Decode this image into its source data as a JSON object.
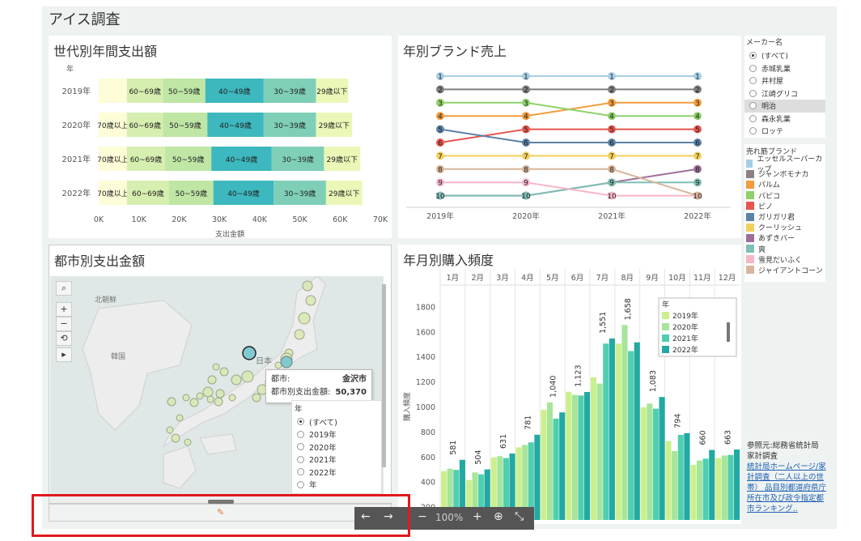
{
  "dashboard_title": "アイス調査",
  "gen_chart": {
    "title": "世代別年間支出額",
    "year_header": "年",
    "xlabel": "支出金額",
    "xticks": [
      "0K",
      "10K",
      "20K",
      "30K",
      "40K",
      "50K",
      "60K",
      "70K"
    ],
    "chart_data": {
      "type": "bar",
      "stacked": true,
      "orientation": "horizontal",
      "categories": [
        "2019年",
        "2020年",
        "2021年",
        "2022年"
      ],
      "series": [
        {
          "name": "70歳以上",
          "values": [
            7000,
            7000,
            7000,
            7000
          ],
          "color": "#fdfdd8"
        },
        {
          "name": "60~69歳",
          "values": [
            9000,
            9000,
            9500,
            10500
          ],
          "color": "#d6eeaf"
        },
        {
          "name": "50~59歳",
          "values": [
            10500,
            11000,
            11500,
            11000
          ],
          "color": "#bfe6a4"
        },
        {
          "name": "40~49歳",
          "values": [
            14500,
            14000,
            15000,
            15000
          ],
          "color": "#3cb8be"
        },
        {
          "name": "30~39歳",
          "values": [
            13000,
            13000,
            13000,
            13000
          ],
          "color": "#7fcfb8"
        },
        {
          "name": "29歳以下",
          "values": [
            8000,
            9000,
            9000,
            9000
          ],
          "color": "#eaf7b7"
        }
      ],
      "xlim": [
        0,
        70000
      ],
      "xlabel": "支出金額"
    }
  },
  "brand_chart": {
    "title": "年別ブランド売上",
    "chart_data": {
      "type": "line",
      "x": [
        "2019年",
        "2020年",
        "2021年",
        "2022年"
      ],
      "series": [
        {
          "name": "エッセルスーパーカップ",
          "values": [
            1,
            1,
            1,
            1
          ],
          "color": "#a6cee3"
        },
        {
          "name": "ジャンボモナカ",
          "values": [
            2,
            2,
            2,
            2
          ],
          "color": "#7f7f7f"
        },
        {
          "name": "パルム",
          "values": [
            4,
            4,
            3,
            3
          ],
          "color": "#f39c3d"
        },
        {
          "name": "パピコ",
          "values": [
            3,
            3,
            4,
            4
          ],
          "color": "#8ed16b"
        },
        {
          "name": "ピノ",
          "values": [
            6,
            5,
            5,
            5
          ],
          "color": "#e8554e"
        },
        {
          "name": "ガリガリ君",
          "values": [
            5,
            6,
            6,
            6
          ],
          "color": "#5b82a6"
        },
        {
          "name": "クーリッシュ",
          "values": [
            7,
            7,
            7,
            7
          ],
          "color": "#f2cf5b"
        },
        {
          "name": "あずきバー",
          "values": [
            10,
            10,
            9,
            8
          ],
          "color": "#9e6e9b"
        },
        {
          "name": "爽",
          "values": [
            10,
            10,
            9,
            9
          ],
          "color": "#7fbfb6"
        },
        {
          "name": "雪見だいふく",
          "values": [
            9,
            9,
            10,
            10
          ],
          "color": "#f7b6c8"
        },
        {
          "name": "ジャイアントコーン",
          "values": [
            8,
            8,
            8,
            10
          ],
          "color": "#d9b59a"
        }
      ],
      "ranks_scale": [
        1,
        10
      ]
    }
  },
  "maker_legend": {
    "title": "メーカー名",
    "items": [
      "(すべて)",
      "赤城乳業",
      "井村屋",
      "江崎グリコ",
      "明治",
      "森永乳業",
      "ロッテ"
    ],
    "selected_index": 0,
    "highlighted_index": 4
  },
  "brand_legend": {
    "title": "売れ筋ブランド",
    "items": [
      {
        "label": "エッセルスーパーカップ",
        "color": "#a6cee3"
      },
      {
        "label": "ジャンボモナカ",
        "color": "#8c8080"
      },
      {
        "label": "パルム",
        "color": "#f39c3d"
      },
      {
        "label": "パピコ",
        "color": "#8ed16b"
      },
      {
        "label": "ピノ",
        "color": "#e8554e"
      },
      {
        "label": "ガリガリ君",
        "color": "#5b82a6"
      },
      {
        "label": "クーリッシュ",
        "color": "#f2cf5b"
      },
      {
        "label": "あずきバー",
        "color": "#9e6e9b"
      },
      {
        "label": "爽",
        "color": "#7fbfb6"
      },
      {
        "label": "雪見だいふく",
        "color": "#f7b6c8"
      },
      {
        "label": "ジャイアントコーン",
        "color": "#d9b59a"
      }
    ]
  },
  "map": {
    "title": "都市別支出金額",
    "label_korea_north": "北朝鮮",
    "label_korea": "韓国",
    "label_japan": "日本",
    "tooltip": {
      "city_label": "都市:",
      "city_value": "金沢市",
      "amount_label": "都市別支出金額:",
      "amount_value": "50,370"
    },
    "year_filter": {
      "title": "年",
      "items": [
        "(すべて)",
        "2019年",
        "2020年",
        "2021年",
        "2022年",
        "年"
      ],
      "selected_index": 0
    }
  },
  "freq_chart": {
    "title": "年月別購入頻度",
    "ylabel": "購入頻度",
    "months": [
      "1月",
      "2月",
      "3月",
      "4月",
      "5月",
      "6月",
      "7月",
      "8月",
      "9月",
      "10月",
      "11月",
      "12月"
    ],
    "yticks": [
      200,
      400,
      600,
      800,
      1000,
      1200,
      1400,
      1600,
      1800
    ],
    "legend_title": "年",
    "chart_data": {
      "type": "bar",
      "categories": [
        "1月",
        "2月",
        "3月",
        "4月",
        "5月",
        "6月",
        "7月",
        "8月",
        "9月",
        "10月",
        "11月",
        "12月"
      ],
      "series": [
        {
          "name": "2019年",
          "values": [
            490,
            420,
            600,
            680,
            980,
            1125,
            1240,
            1510,
            1000,
            730,
            540,
            595
          ],
          "color": "#ccef8e"
        },
        {
          "name": "2020年",
          "values": [
            510,
            480,
            610,
            700,
            1040,
            1100,
            1190,
            1658,
            1030,
            650,
            575,
            615
          ],
          "color": "#a7e59a"
        },
        {
          "name": "2021年",
          "values": [
            500,
            465,
            595,
            720,
            910,
            1095,
            1510,
            1450,
            990,
            780,
            590,
            620
          ],
          "color": "#4fcfb0"
        },
        {
          "name": "2022年",
          "values": [
            581,
            504,
            631,
            781,
            960,
            1123,
            1551,
            1520,
            1083,
            794,
            660,
            663
          ],
          "color": "#22a9a3"
        }
      ],
      "labels": {
        "1月": 581,
        "2月": 504,
        "3月": 631,
        "4月": 781,
        "5月": 1040,
        "6月": 1123,
        "7月": 1551,
        "8月": 1658,
        "9月": 1083,
        "10月": 794,
        "11月": 660,
        "12月": 663
      },
      "ylim": [
        100,
        1900
      ],
      "ylabel": "購入頻度"
    }
  },
  "source": {
    "line1": "参照元:総務省統計局",
    "line2": "家計調査",
    "link": "統計局ホームページ/家計調査（二人以上の世帯） 品目別都道府県庁所在市及び政令指定都市ランキング.."
  },
  "toolbar": {
    "back": "←",
    "forward": "→",
    "zoom_out": "−",
    "zoom": "100%",
    "zoom_in": "+",
    "download": "⊕",
    "fullscreen": "⤡"
  }
}
